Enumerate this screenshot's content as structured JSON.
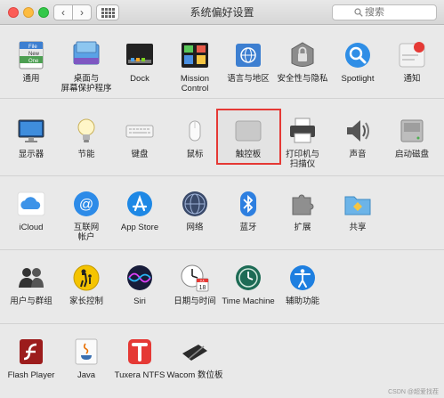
{
  "window": {
    "title": "系统偏好设置",
    "search_placeholder": "搜索"
  },
  "nav": {
    "back": "‹",
    "forward": "›"
  },
  "rows": [
    [
      {
        "label": "通用",
        "icon": "general-icon"
      },
      {
        "label": "桌面与\n屏幕保护程序",
        "icon": "desktop-screensaver-icon"
      },
      {
        "label": "Dock",
        "icon": "dock-icon"
      },
      {
        "label": "Mission\nControl",
        "icon": "mission-control-icon"
      },
      {
        "label": "语言与地区",
        "icon": "language-region-icon"
      },
      {
        "label": "安全性与隐私",
        "icon": "security-privacy-icon"
      },
      {
        "label": "Spotlight",
        "icon": "spotlight-icon"
      },
      {
        "label": "通知",
        "icon": "notifications-icon"
      }
    ],
    [
      {
        "label": "显示器",
        "icon": "displays-icon"
      },
      {
        "label": "节能",
        "icon": "energy-saver-icon"
      },
      {
        "label": "键盘",
        "icon": "keyboard-icon"
      },
      {
        "label": "鼠标",
        "icon": "mouse-icon"
      },
      {
        "label": "触控板",
        "icon": "trackpad-icon"
      },
      {
        "label": "打印机与\n扫描仪",
        "icon": "printers-scanners-icon"
      },
      {
        "label": "声音",
        "icon": "sound-icon"
      },
      {
        "label": "启动磁盘",
        "icon": "startup-disk-icon"
      }
    ],
    [
      {
        "label": "iCloud",
        "icon": "icloud-icon"
      },
      {
        "label": "互联网\n帐户",
        "icon": "internet-accounts-icon"
      },
      {
        "label": "App Store",
        "icon": "app-store-icon"
      },
      {
        "label": "网络",
        "icon": "network-icon"
      },
      {
        "label": "蓝牙",
        "icon": "bluetooth-icon"
      },
      {
        "label": "扩展",
        "icon": "extensions-icon"
      },
      {
        "label": "共享",
        "icon": "sharing-icon"
      }
    ],
    [
      {
        "label": "用户与群组",
        "icon": "users-groups-icon"
      },
      {
        "label": "家长控制",
        "icon": "parental-controls-icon"
      },
      {
        "label": "Siri",
        "icon": "siri-icon"
      },
      {
        "label": "日期与时间",
        "icon": "date-time-icon"
      },
      {
        "label": "Time Machine",
        "icon": "time-machine-icon"
      },
      {
        "label": "辅助功能",
        "icon": "accessibility-icon"
      }
    ],
    [
      {
        "label": "Flash Player",
        "icon": "flash-player-icon"
      },
      {
        "label": "Java",
        "icon": "java-icon"
      },
      {
        "label": "Tuxera NTFS",
        "icon": "tuxera-ntfs-icon"
      },
      {
        "label": "Wacom 数位板",
        "icon": "wacom-tablet-icon"
      }
    ]
  ],
  "calendar": {
    "month": "JUL",
    "day": "18"
  },
  "general_icon_text": [
    "File",
    "New",
    "One"
  ],
  "watermark": "CSDN @超爱找茬",
  "colors": {
    "highlight_border": "#e53935",
    "notification_badge": "#e53935"
  }
}
